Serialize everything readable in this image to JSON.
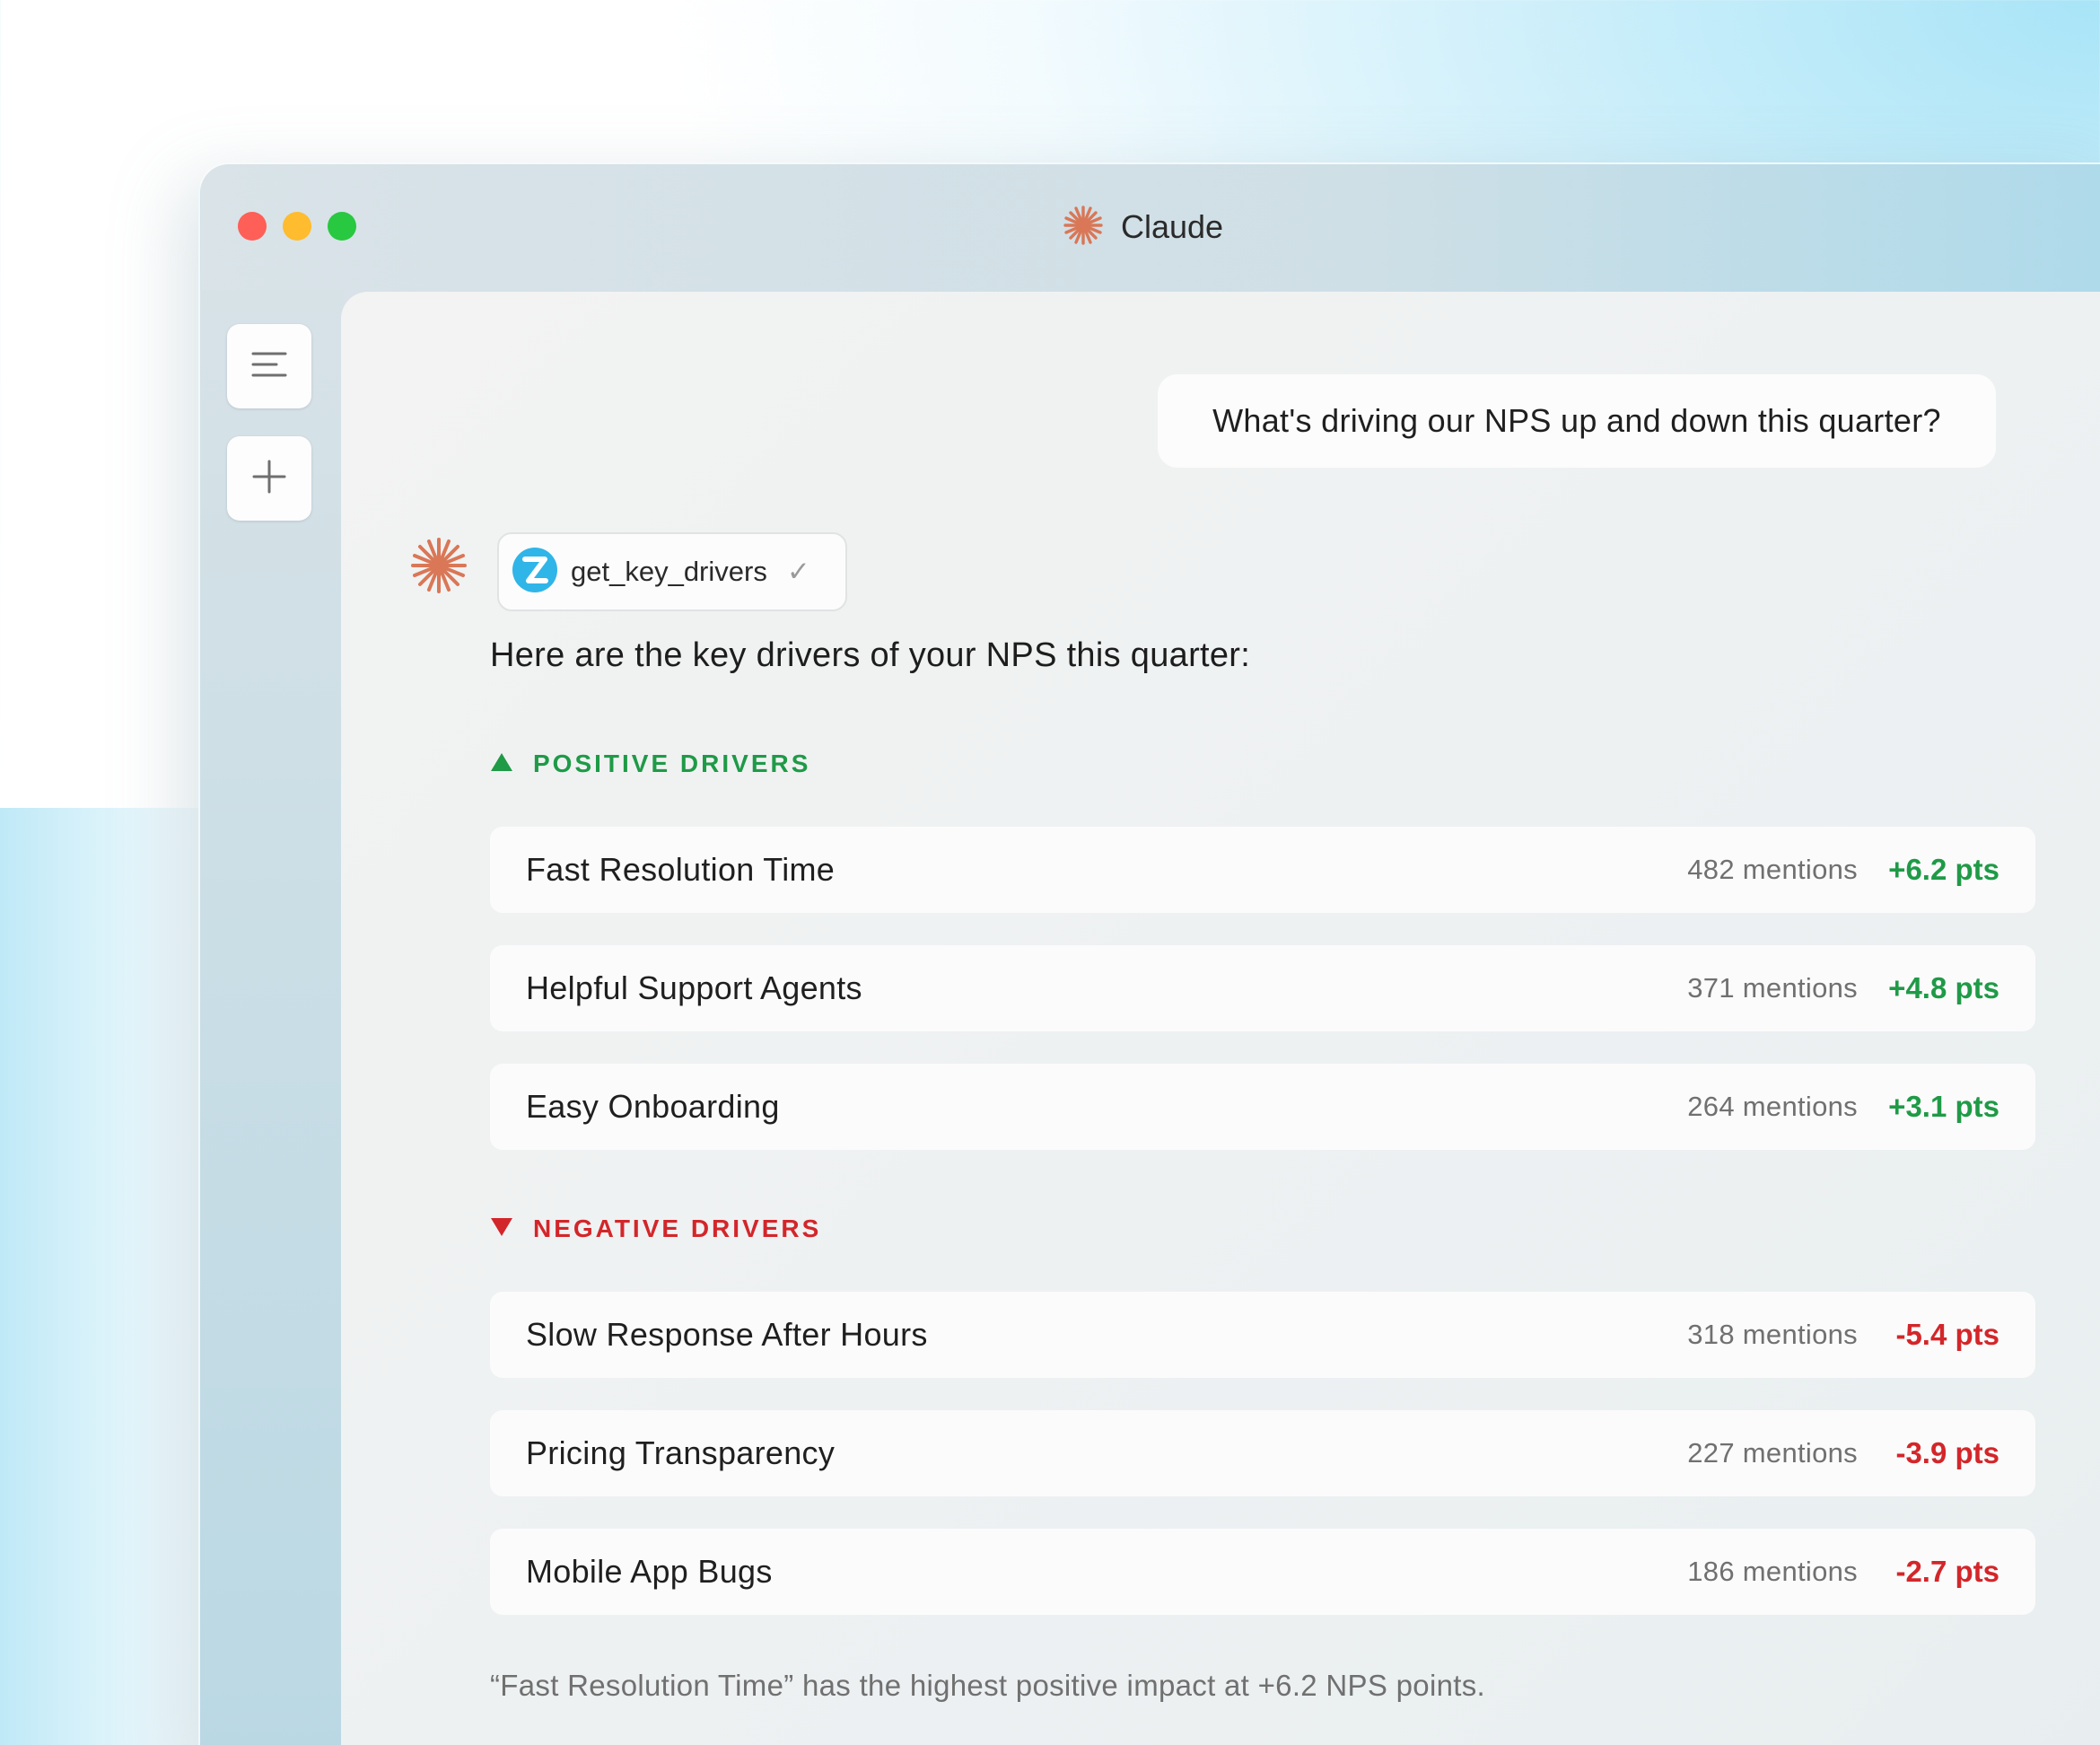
{
  "window": {
    "title": "Claude"
  },
  "conversation": {
    "user_message": "What's driving our NPS up and down this quarter?",
    "tool_call": {
      "name": "get_key_drivers",
      "status_symbol": "✓"
    },
    "intro": "Here are the key drivers of your NPS this quarter:",
    "positive": {
      "header": "POSITIVE DRIVERS",
      "items": [
        {
          "label": "Fast Resolution Time",
          "mentions": "482 mentions",
          "impact": "+6.2 pts"
        },
        {
          "label": "Helpful Support Agents",
          "mentions": "371 mentions",
          "impact": "+4.8 pts"
        },
        {
          "label": "Easy Onboarding",
          "mentions": "264 mentions",
          "impact": "+3.1 pts"
        }
      ]
    },
    "negative": {
      "header": "NEGATIVE DRIVERS",
      "items": [
        {
          "label": "Slow Response After Hours",
          "mentions": "318 mentions",
          "impact": "-5.4 pts"
        },
        {
          "label": "Pricing Transparency",
          "mentions": "227 mentions",
          "impact": "-3.9 pts"
        },
        {
          "label": "Mobile App Bugs",
          "mentions": "186 mentions",
          "impact": "-2.7 pts"
        }
      ]
    },
    "summary": "“Fast Resolution Time” has the highest positive impact at +6.2 NPS points."
  },
  "colors": {
    "positive": "#1f9a47",
    "negative": "#d3262a",
    "claude_accent": "#d97757",
    "tool_brand": "#2fb5e8"
  },
  "icons": {
    "sidebar_menu": "menu-icon",
    "sidebar_new": "plus-icon",
    "claude": "claude-spark-icon",
    "tool": "zendesk-z-icon"
  }
}
